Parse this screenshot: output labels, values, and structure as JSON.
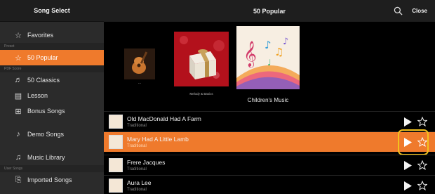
{
  "sidebar": {
    "header": "Song Select",
    "favorites": "Favorites",
    "section_preset": "Preset",
    "popular": "50 Popular",
    "section_pdf": "PDF Score",
    "classics": "50 Classics",
    "lesson": "Lesson",
    "bonus": "Bonus Songs",
    "demo": "Demo Songs",
    "music_library": "Music Library",
    "section_user": "User Songs",
    "imported": "Imported Songs"
  },
  "topbar": {
    "title": "50 Popular",
    "close_label": "Close"
  },
  "albums": [
    {
      "caption": "..."
    },
    {
      "caption": "Melody & Basics"
    },
    {
      "caption": "Children's Music"
    }
  ],
  "songs": [
    {
      "title": "Old MacDonald Had A Farm",
      "subtitle": "Traditional",
      "selected": false
    },
    {
      "title": "Mary Had A Little Lamb",
      "subtitle": "Traditional",
      "selected": true
    },
    {
      "title": "Frere Jacques",
      "subtitle": "Traditional",
      "selected": false
    },
    {
      "title": "Aura Lee",
      "subtitle": "Traditional",
      "selected": false
    }
  ],
  "colors": {
    "accent": "#ef7a2c",
    "highlight": "#f2c21e"
  }
}
